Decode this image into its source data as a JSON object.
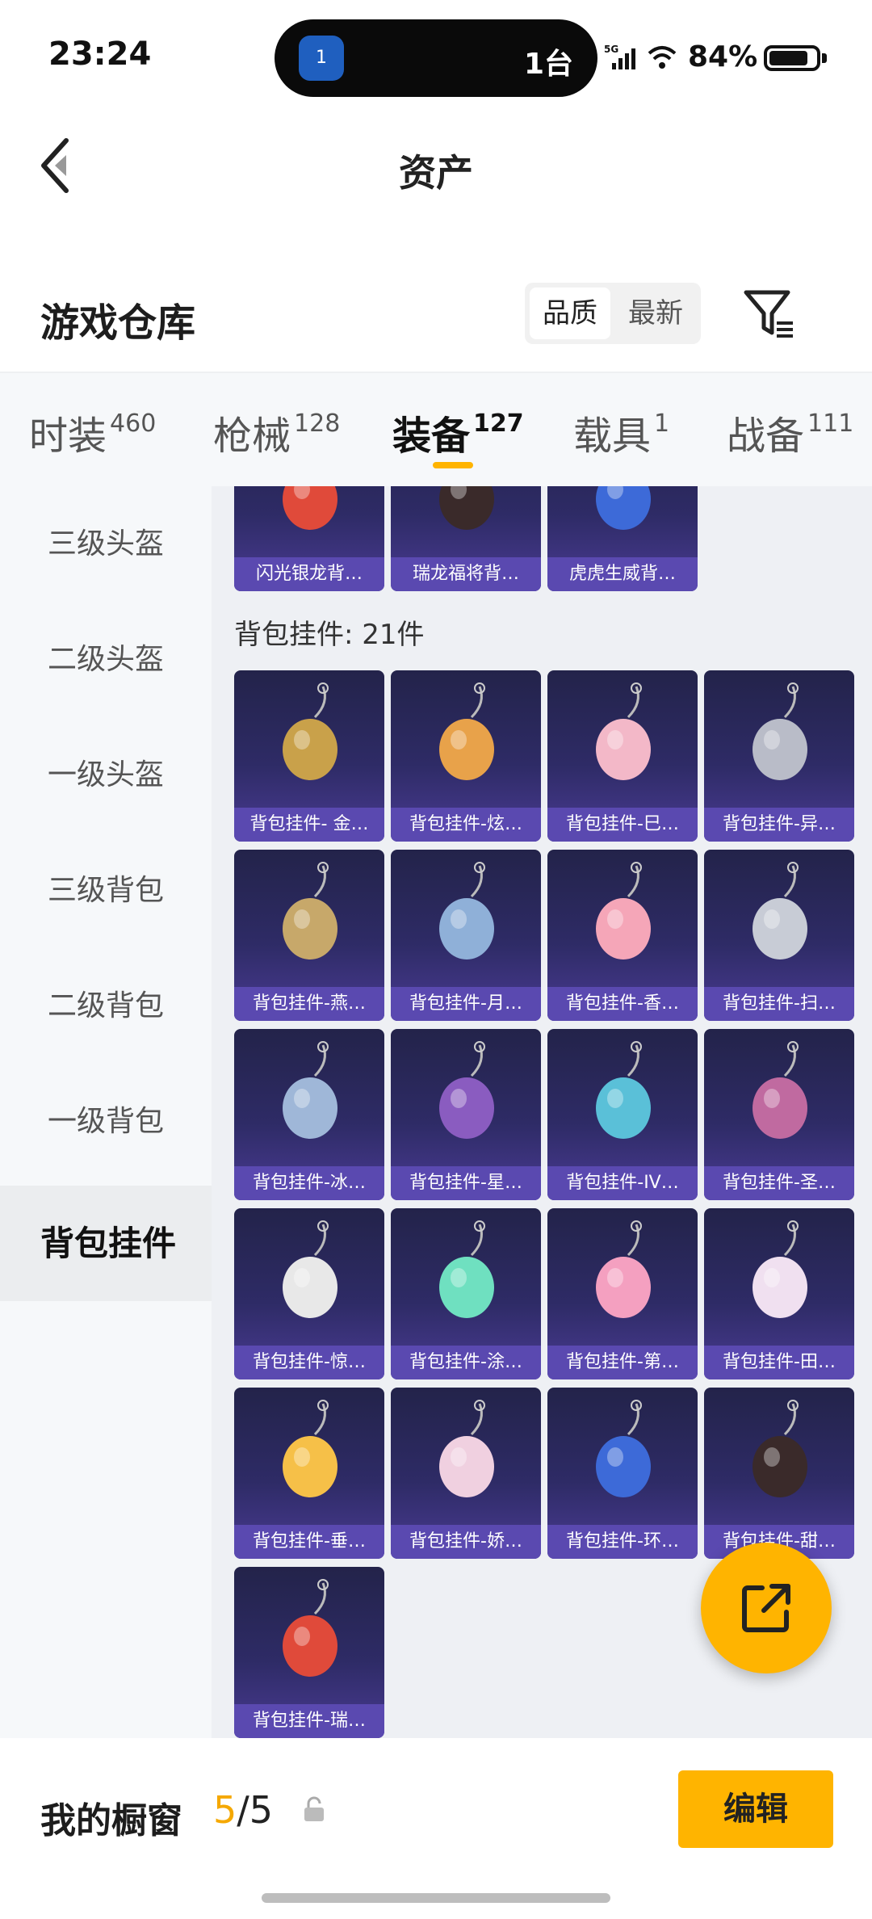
{
  "status_bar": {
    "time": "23:24",
    "island_app_text": "1",
    "island_text": "1台",
    "network": "5G",
    "battery": "84%",
    "battery_level": 0.84
  },
  "nav": {
    "title": "资产"
  },
  "warehouse": {
    "title": "游戏仓库",
    "sort_options": [
      "品质",
      "最新"
    ],
    "sort_selected": "品质"
  },
  "tabs": [
    {
      "label": "时装",
      "count": "460"
    },
    {
      "label": "枪械",
      "count": "128"
    },
    {
      "label": "装备",
      "count": "127",
      "active": true
    },
    {
      "label": "载具",
      "count": "1"
    },
    {
      "label": "战备",
      "count": "111"
    }
  ],
  "sidebar": {
    "items": [
      "三级头盔",
      "二级头盔",
      "一级头盔",
      "三级背包",
      "二级背包",
      "一级背包",
      "背包挂件"
    ],
    "active": "背包挂件"
  },
  "top_cards": [
    "闪光银龙背…",
    "瑞龙福将背…",
    "虎虎生威背…"
  ],
  "section": {
    "title": "背包挂件: 21件"
  },
  "pendants": [
    "背包挂件- 金…",
    "背包挂件-炫…",
    "背包挂件-巳…",
    "背包挂件-异…",
    "背包挂件-燕…",
    "背包挂件-月…",
    "背包挂件-香…",
    "背包挂件-扫…",
    "背包挂件-冰…",
    "背包挂件-星…",
    "背包挂件-IV…",
    "背包挂件-圣…",
    "背包挂件-惊…",
    "背包挂件-涂…",
    "背包挂件-第…",
    "背包挂件-田…",
    "背包挂件-垂…",
    "背包挂件-娇…",
    "背包挂件-环…",
    "背包挂件-甜…",
    "背包挂件-瑞…"
  ],
  "bottom": {
    "showcase_label": "我的橱窗",
    "showcase_used": "5",
    "showcase_total": "/5",
    "edit_label": "编辑"
  },
  "colors": {
    "accent": "#ffb400",
    "card_top": "#23234a",
    "card_bottom": "#4a3b93",
    "card_strip": "#5a49b0"
  }
}
